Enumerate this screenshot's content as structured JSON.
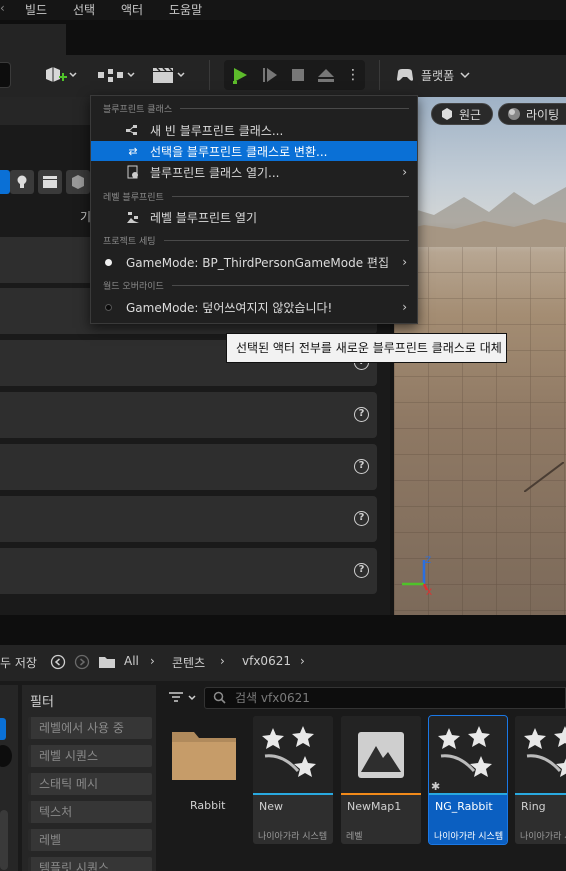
{
  "menubar": {
    "items": [
      "빌드",
      "선택",
      "액터",
      "도움말"
    ]
  },
  "toolbar": {
    "platform_label": "플랫폼"
  },
  "viewport": {
    "pill1": "원근",
    "pill2": "라이팅"
  },
  "menu": {
    "section_blueprint": "블루프린트 클래스",
    "new_blueprint": "새 빈 블루프린트 클래스...",
    "convert_selection": "선택을 블루프린트 클래스로 변환...",
    "open_blueprint": "블루프린트 클래스 열기...",
    "section_level_bp": "레벨 블루프린트",
    "open_level_bp": "레벨 블루프린트 열기",
    "section_project": "프로젝트 세팅",
    "project_gamemode": "GameMode: BP_ThirdPersonGameMode 편집",
    "section_world": "월드 오버라이드",
    "world_gamemode": "GameMode: 덮어쓰여지지 않았습니다!"
  },
  "tooltip": "선택된 액터 전부를 새로운 블루프린트 클래스로 대체",
  "leftpane": {
    "label": "기"
  },
  "content_browser": {
    "save_label": "두 저장",
    "breadcrumb": [
      "All",
      "콘텐츠",
      "vfx0621"
    ],
    "search_placeholder": "검색 vfx0621",
    "filter_title": "필터",
    "filters": [
      "레벨에서 사용 중",
      "레벨 시퀀스",
      "스태틱 메시",
      "텍스처",
      "레벨",
      "템플릿 시퀀스"
    ],
    "assets": [
      {
        "name": "Rabbit",
        "type": "",
        "kind": "folder"
      },
      {
        "name": "New",
        "type": "나이아가라 시스템",
        "kind": "niagara"
      },
      {
        "name": "NewMap1",
        "type": "레벨",
        "kind": "level"
      },
      {
        "name": "NG_Rabbit",
        "type": "나이아가라 시스템",
        "kind": "niagara"
      },
      {
        "name": "Ring",
        "type": "나이아가라 시스템",
        "kind": "niagara"
      }
    ]
  },
  "colors": {
    "accent": "#0a70d6",
    "play_green": "#5dbb2b",
    "niagara_bar": "#29a9e0",
    "level_bar": "#f28a1a"
  }
}
